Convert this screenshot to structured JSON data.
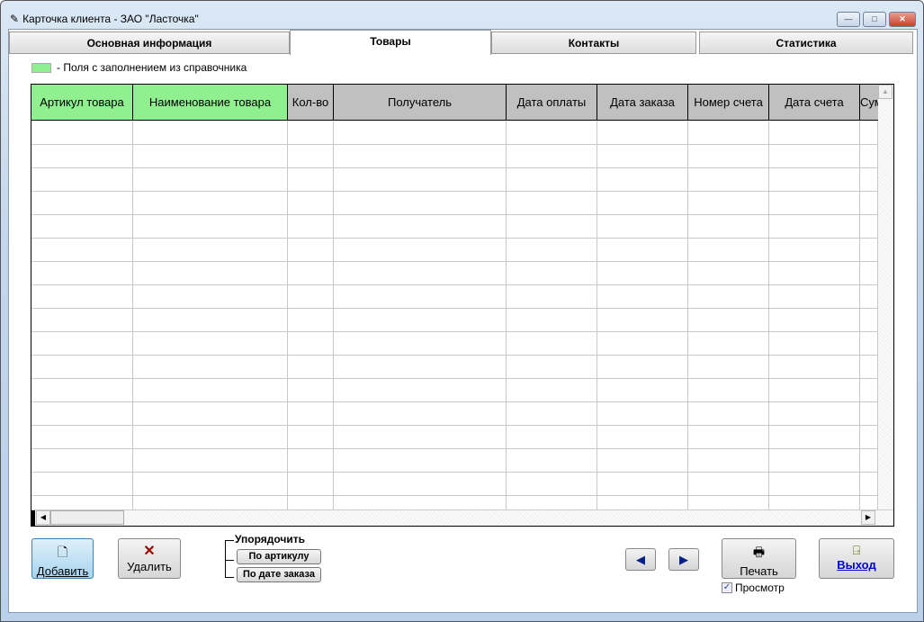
{
  "window": {
    "title": "Карточка клиента  -  ЗАО \"Ласточка\"",
    "minimize": "—",
    "maximize": "□",
    "close": "✕"
  },
  "tabs": [
    {
      "label": "Основная информация"
    },
    {
      "label": "Товары"
    },
    {
      "label": "Контакты"
    },
    {
      "label": "Статистика"
    }
  ],
  "legend": {
    "text": "- Поля с заполнением из справочника",
    "color": "#90f090"
  },
  "grid": {
    "columns": [
      "Артикул товара",
      "Наименование товара",
      "Кол-во",
      "Получатель",
      "Дата оплаты",
      "Дата заказа",
      "Номер счета",
      "Дата счета",
      "Сумма"
    ]
  },
  "buttons": {
    "add": "Добавить",
    "delete": "Удалить",
    "print": "Печать",
    "exit": "Выход"
  },
  "sort": {
    "label": "Упорядочить",
    "by_article": "По артикулу",
    "by_order_date": "По дате заказа"
  },
  "preview": {
    "label": "Просмотр",
    "checked": true
  }
}
